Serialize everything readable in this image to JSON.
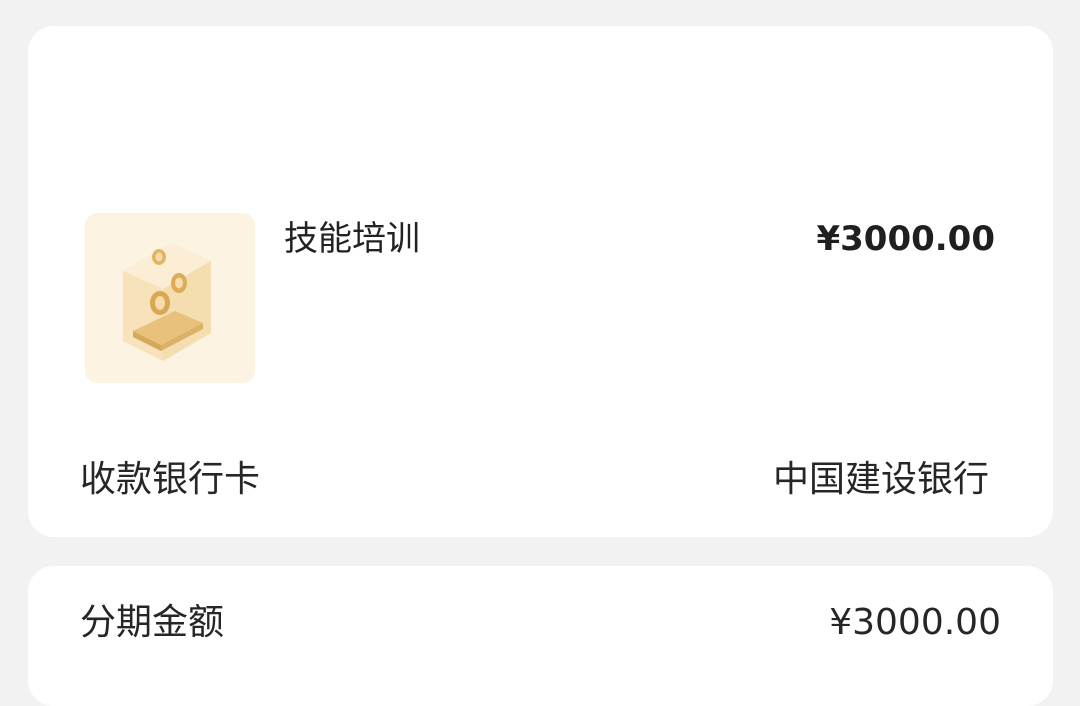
{
  "order": {
    "thumbnail_icon": "gold-coin-box-icon",
    "product_name": "技能培训",
    "product_price": "¥3000.00"
  },
  "bank": {
    "label": "收款银行卡",
    "value": "中国建设银行"
  },
  "installment": {
    "label": "分期金额",
    "value": "¥3000.00"
  },
  "colors": {
    "background": "#f2f2f2",
    "card": "#ffffff",
    "thumbnail_bg": "#fdf3e3",
    "gold": "#e9c27a"
  }
}
